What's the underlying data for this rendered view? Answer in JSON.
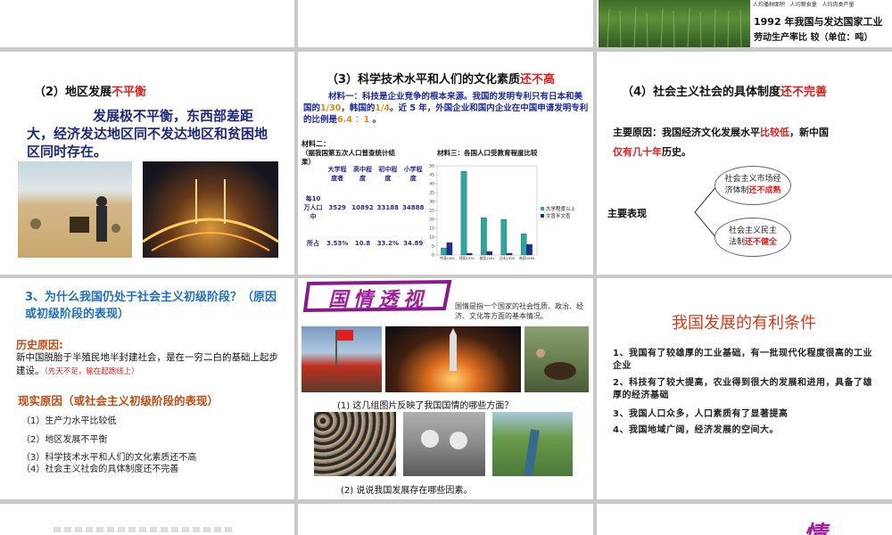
{
  "top_right": {
    "caption_small": [
      "人均播种面积",
      "人均粮食量",
      "人均肉类产量",
      "人均粮食量"
    ],
    "caption_line1": "1992 年我国与发达国家工业",
    "caption_line2": "劳动生产率比  较（单位：吨）"
  },
  "slide_regional": {
    "title_prefix": "（2）地区发展",
    "title_red": "不平衡",
    "body": "发展极不平衡，东西部差距大，经济发达地区同不发达地区和贫困地区同时存在。"
  },
  "slide_science": {
    "title_prefix": "（3）科学技术水平和人们的文化素质",
    "title_red": "还不高",
    "material1_a": "材料一：科技是企业竞争的根本来源。我国的发明专利只有日本和美国的",
    "material1_r1": "1/30",
    "material1_b": "，韩国的",
    "material1_r2": "1/4",
    "material1_c": "。近 5  年，外国企业和国内企业在中国申请发明专利的比例是",
    "material1_r3": "6.4 ：1",
    "material1_d": " 。",
    "material2_title": "材料二：",
    "material2_sub": "（据我国第五次人口普查统计结果）",
    "table_headers": [
      "大学程度者",
      "高中程度",
      "初中程度",
      "小学程度"
    ],
    "row_label": "每10万人口中",
    "row_values": [
      "3529",
      "10892",
      "33188",
      "34888"
    ],
    "row2_label": "所占",
    "row2_values": [
      "3.53%",
      "10.8",
      "33.2%",
      "34.89"
    ],
    "material3_title": "材料三：各国人口受教育程度比较"
  },
  "chart_data": {
    "type": "bar",
    "title": "材料三：各国人口受教育程度比较",
    "categories": [
      "中国2000",
      "德国1991",
      "美国1991",
      "日本1990",
      "韩国1995"
    ],
    "series": [
      {
        "name": "大学程度以上",
        "values": [
          4,
          47,
          21,
          20,
          12
        ],
        "color": "#2aa8a0"
      },
      {
        "name": "文盲半文盲",
        "values": [
          7,
          1,
          2,
          1,
          6
        ],
        "color": "#1e2f8a"
      }
    ],
    "ylim": [
      0,
      50
    ],
    "yticks": [
      "0",
      "5",
      "10",
      "15",
      "20",
      "25",
      "30",
      "35",
      "40",
      "45",
      "50"
    ],
    "legend": "right"
  },
  "slide_system": {
    "title_prefix": "（4）社会主义社会的具体制度",
    "title_red": "还不完善",
    "reason_label": "主要原因：",
    "reason_a": "我国经济文化发展水平",
    "reason_r1": "比较低",
    "reason_b": "，新中国",
    "reason_r2": "仅有几十年",
    "reason_c": "历史。",
    "main_label": "主要表现",
    "oval1_a": "社会主义市场经",
    "oval1_b": "济体制",
    "oval1_r": "还不成熟",
    "oval2_a": "社会主义民主",
    "oval2_b": "法制",
    "oval2_r": "还不健全"
  },
  "slide_why": {
    "title": "3、为什么我国仍处于社会主义初级阶段？（原因或初级阶段的表现）",
    "history_label": "历史原因:",
    "history_text": "新中国脱胎于半殖民地半封建社会，是在一穷二白的基础上起步建设。",
    "history_note": "（先天不足，输在起跑线上）",
    "reality_label": "现实原因（或社会主义初级阶段的表现）",
    "items": [
      "（1）生产力水平比较低",
      "（2）地区发展不平衡",
      "（3）科学技术水平和人们的文化素质还不高",
      "（4）社会主义社会的具体制度还不完善"
    ]
  },
  "slide_national": {
    "banner": "国情透视",
    "definition": "国情是指一个国家的社会性质、政治、经济、文化等方面的基本情况。",
    "q1": "(1) 这几组图片反映了我国国情的哪些方面？",
    "q2": "(2) 说说我国发展存在哪些因素。"
  },
  "slide_favorable": {
    "title": "我国发展的有利条件",
    "items": [
      "1、我国有了较雄厚的工业基础，有一批现代化程度很高的工业企业",
      "2、科技有了较大提高，农业得到很大的发展和进用，具备了雄厚的经济基础",
      "3、我国人口众多，人口素质有了显著提高",
      "4、我国地域广阔，经济发展的空间大。"
    ]
  },
  "bottom_right": {
    "fragment": "情"
  }
}
